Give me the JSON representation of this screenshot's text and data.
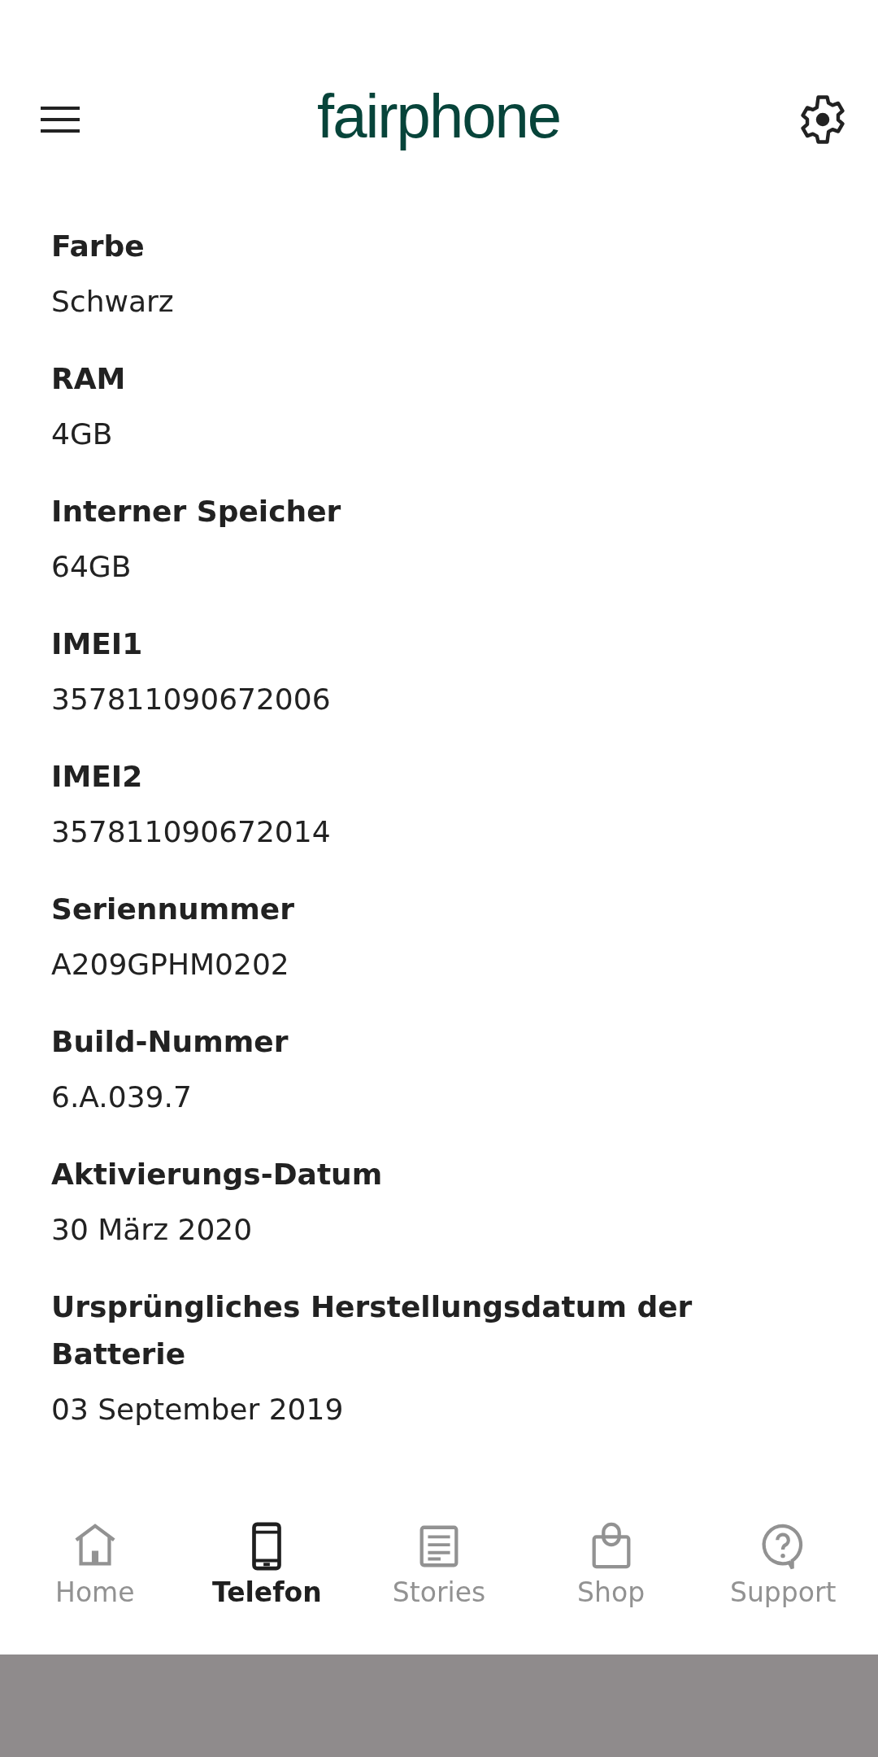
{
  "header": {
    "logo": "fairphone"
  },
  "details": [
    {
      "label": "Farbe",
      "value": "Schwarz"
    },
    {
      "label": "RAM",
      "value": "4GB"
    },
    {
      "label": "Interner Speicher",
      "value": "64GB"
    },
    {
      "label": "IMEI1",
      "value": "357811090672006"
    },
    {
      "label": "IMEI2",
      "value": "357811090672014"
    },
    {
      "label": "Seriennummer",
      "value": "A209GPHM0202"
    },
    {
      "label": "Build-Nummer",
      "value": "6.A.039.7"
    },
    {
      "label": "Aktivierungs-Datum",
      "value": "30 März 2020"
    },
    {
      "label": "Ursprüngliches Herstellungsdatum der Batterie",
      "value": "03 September 2019"
    }
  ],
  "nav": [
    {
      "kind": "home",
      "label": "Home",
      "selected": false
    },
    {
      "kind": "phone",
      "label": "Telefon",
      "selected": true
    },
    {
      "kind": "stories",
      "label": "Stories",
      "selected": false
    },
    {
      "kind": "shop",
      "label": "Shop",
      "selected": false
    },
    {
      "kind": "support",
      "label": "Support",
      "selected": false
    }
  ]
}
